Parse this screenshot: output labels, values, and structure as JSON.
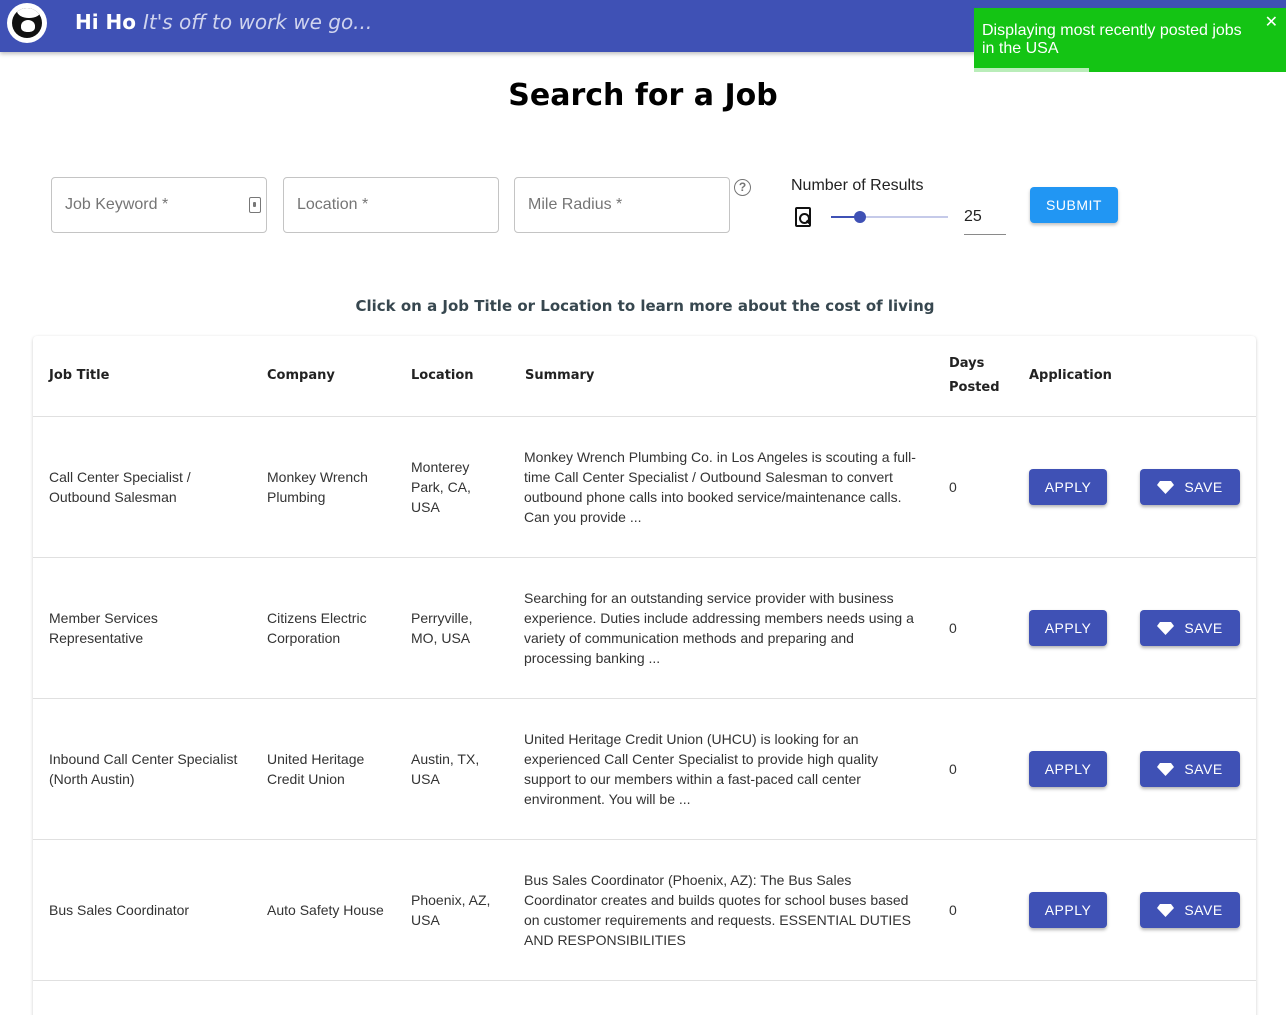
{
  "header": {
    "brand": "Hi Ho",
    "tagline": "It's off to work we go...",
    "logo_icon": "dwarf-logo-icon",
    "background": "#3f51b5"
  },
  "toast": {
    "message": "Displaying most recently posted jobs in the USA",
    "close": "✕",
    "background": "#14c414",
    "progress": 0.37
  },
  "page": {
    "title": "Search for a Job"
  },
  "search": {
    "keyword_placeholder": "Job Keyword *",
    "location_placeholder": "Location *",
    "radius_placeholder": "Mile Radius *",
    "help": "?",
    "results_label": "Number of Results",
    "results_value": "25",
    "results_min": 0,
    "results_max": 100,
    "submit_label": "SUBMIT"
  },
  "hint": "Click on a Job Title or Location to learn more about the cost of living",
  "table": {
    "headers": {
      "job_title": "Job Title",
      "company": "Company",
      "location": "Location",
      "summary": "Summary",
      "days_line1": "Days",
      "days_line2": "Posted",
      "application": "Application"
    },
    "apply_label": "APPLY",
    "save_label": "SAVE",
    "rows": [
      {
        "title": "Call Center Specialist / Outbound Salesman",
        "company": "Monkey Wrench Plumbing",
        "location": "Monterey Park, CA, USA",
        "summary": "Monkey Wrench Plumbing Co. in Los Angeles is scouting a full-time Call Center Specialist / Outbound Salesman to convert outbound phone calls into booked service/maintenance calls. Can you provide ...",
        "days": "0"
      },
      {
        "title": "Member Services Representative",
        "company": "Citizens Electric Corporation",
        "location": "Perryville, MO, USA",
        "summary": "Searching for an outstanding service provider with business experience. Duties include addressing members needs using a variety of communication methods and preparing and processing banking ...",
        "days": "0"
      },
      {
        "title": "Inbound Call Center Specialist (North Austin)",
        "company": "United Heritage Credit Union",
        "location": "Austin, TX, USA",
        "summary": "United Heritage Credit Union (UHCU) is looking for an experienced Call Center Specialist to provide high quality support to our members within a fast-paced call center environment. You will be ...",
        "days": "0"
      },
      {
        "title": "Bus Sales Coordinator",
        "company": "Auto Safety House",
        "location": "Phoenix, AZ, USA",
        "summary": "Bus Sales Coordinator (Phoenix, AZ): The Bus Sales Coordinator creates and builds quotes for school buses based on customer requirements and requests. ESSENTIAL DUTIES AND RESPONSIBILITIES",
        "days": "0"
      }
    ]
  }
}
